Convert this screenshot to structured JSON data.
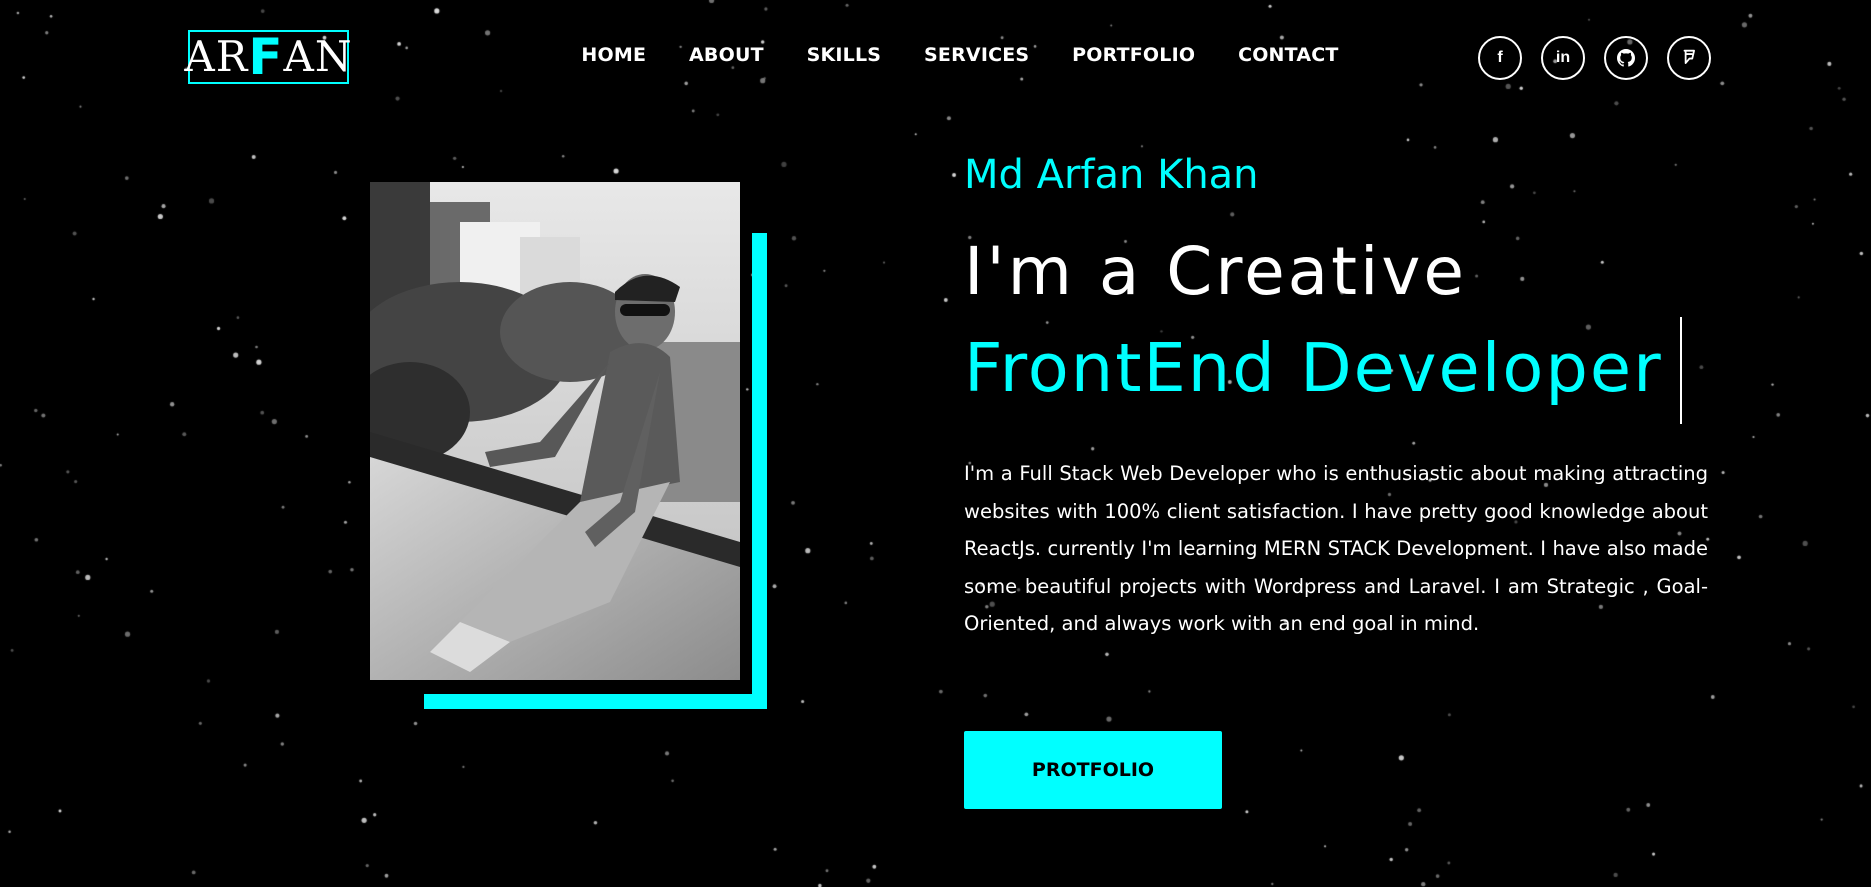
{
  "header": {
    "logo": {
      "part1": "AR",
      "accent": "F",
      "part2": "AN"
    },
    "nav": [
      "HOME",
      "ABOUT",
      "SKILLS",
      "SERVICES",
      "PORTFOLIO",
      "CONTACT"
    ],
    "social": [
      {
        "name": "facebook-icon",
        "glyph": "f"
      },
      {
        "name": "linkedin-icon",
        "glyph": "in"
      },
      {
        "name": "github-icon",
        "glyph": ""
      },
      {
        "name": "foursquare-icon",
        "glyph": ""
      }
    ]
  },
  "hero": {
    "name": "Md Arfan Khan",
    "line1": "I'm a Creative",
    "line2": "FrontEnd Developer",
    "paragraph": "I'm a Full Stack Web Developer who is enthusiastic about making attracting websites with 100% client satisfaction. I have pretty good knowledge about ReactJs. currently I'm learning MERN STACK Development. I have also made some beautiful projects with Wordpress and Laravel. I am Strategic , Goal-Oriented, and always work with an end goal in mind.",
    "cta_label": "PROTFOLIO"
  },
  "colors": {
    "accent": "#00ffff",
    "background": "#000000",
    "text": "#ffffff"
  }
}
